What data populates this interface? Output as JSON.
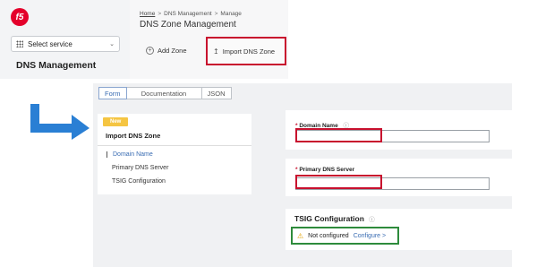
{
  "top": {
    "logo": "f5",
    "service_select": "Select service",
    "sidebar_title": "DNS Management",
    "breadcrumb": {
      "home": "Home",
      "section": "DNS Management",
      "current": "Manage",
      "sep": ">"
    },
    "page_title": "DNS Zone Management",
    "add_zone": "Add Zone",
    "import_zone": "Import DNS Zone"
  },
  "bottom": {
    "tabs": [
      "Form",
      "Documentation",
      "JSON"
    ],
    "badge": "New",
    "nav_title": "Import DNS Zone",
    "nav_items": [
      "Domain Name",
      "Primary DNS Server",
      "TSIG Configuration"
    ],
    "domain_label": "Domain Name",
    "primary_label": "Primary DNS Server",
    "required_mark": "*",
    "tsig_title": "TSIG Configuration",
    "tsig_status": "Not configured",
    "tsig_configure": "Configure",
    "tsig_chevron": ">"
  },
  "colors": {
    "highlight_red": "#c8102e",
    "highlight_green": "#2e8b3c",
    "arrow_blue": "#2a7fd4",
    "link_blue": "#3a6db3"
  },
  "icons": [
    "f5-logo",
    "grid-icon",
    "chevron-down-icon",
    "plus-circle-icon",
    "upload-icon",
    "info-icon",
    "warning-icon",
    "chevron-right-icon",
    "arrow-down-right-icon"
  ]
}
